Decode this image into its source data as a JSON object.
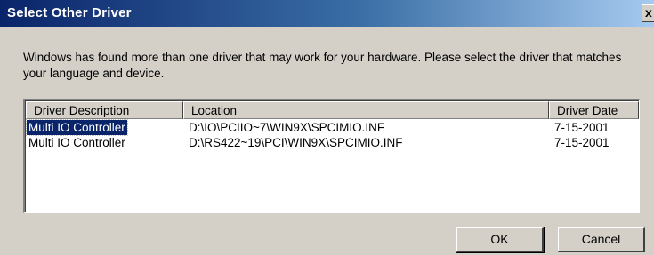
{
  "window": {
    "title": "Select Other Driver",
    "close_glyph": "x"
  },
  "message": "Windows has found more than one driver that may work for your hardware.  Please select the driver that matches your language and device.",
  "list": {
    "columns": [
      "Driver Description",
      "Location",
      "Driver Date"
    ],
    "rows": [
      {
        "description": "Multi IO Controller",
        "location": "D:\\IO\\PCIIO~7\\WIN9X\\SPCIMIO.INF",
        "date": "7-15-2001",
        "selected": true
      },
      {
        "description": "Multi IO Controller",
        "location": "D:\\RS422~19\\PCI\\WIN9X\\SPCIMIO.INF",
        "date": "7-15-2001",
        "selected": false
      }
    ]
  },
  "buttons": {
    "ok": "OK",
    "cancel": "Cancel"
  }
}
